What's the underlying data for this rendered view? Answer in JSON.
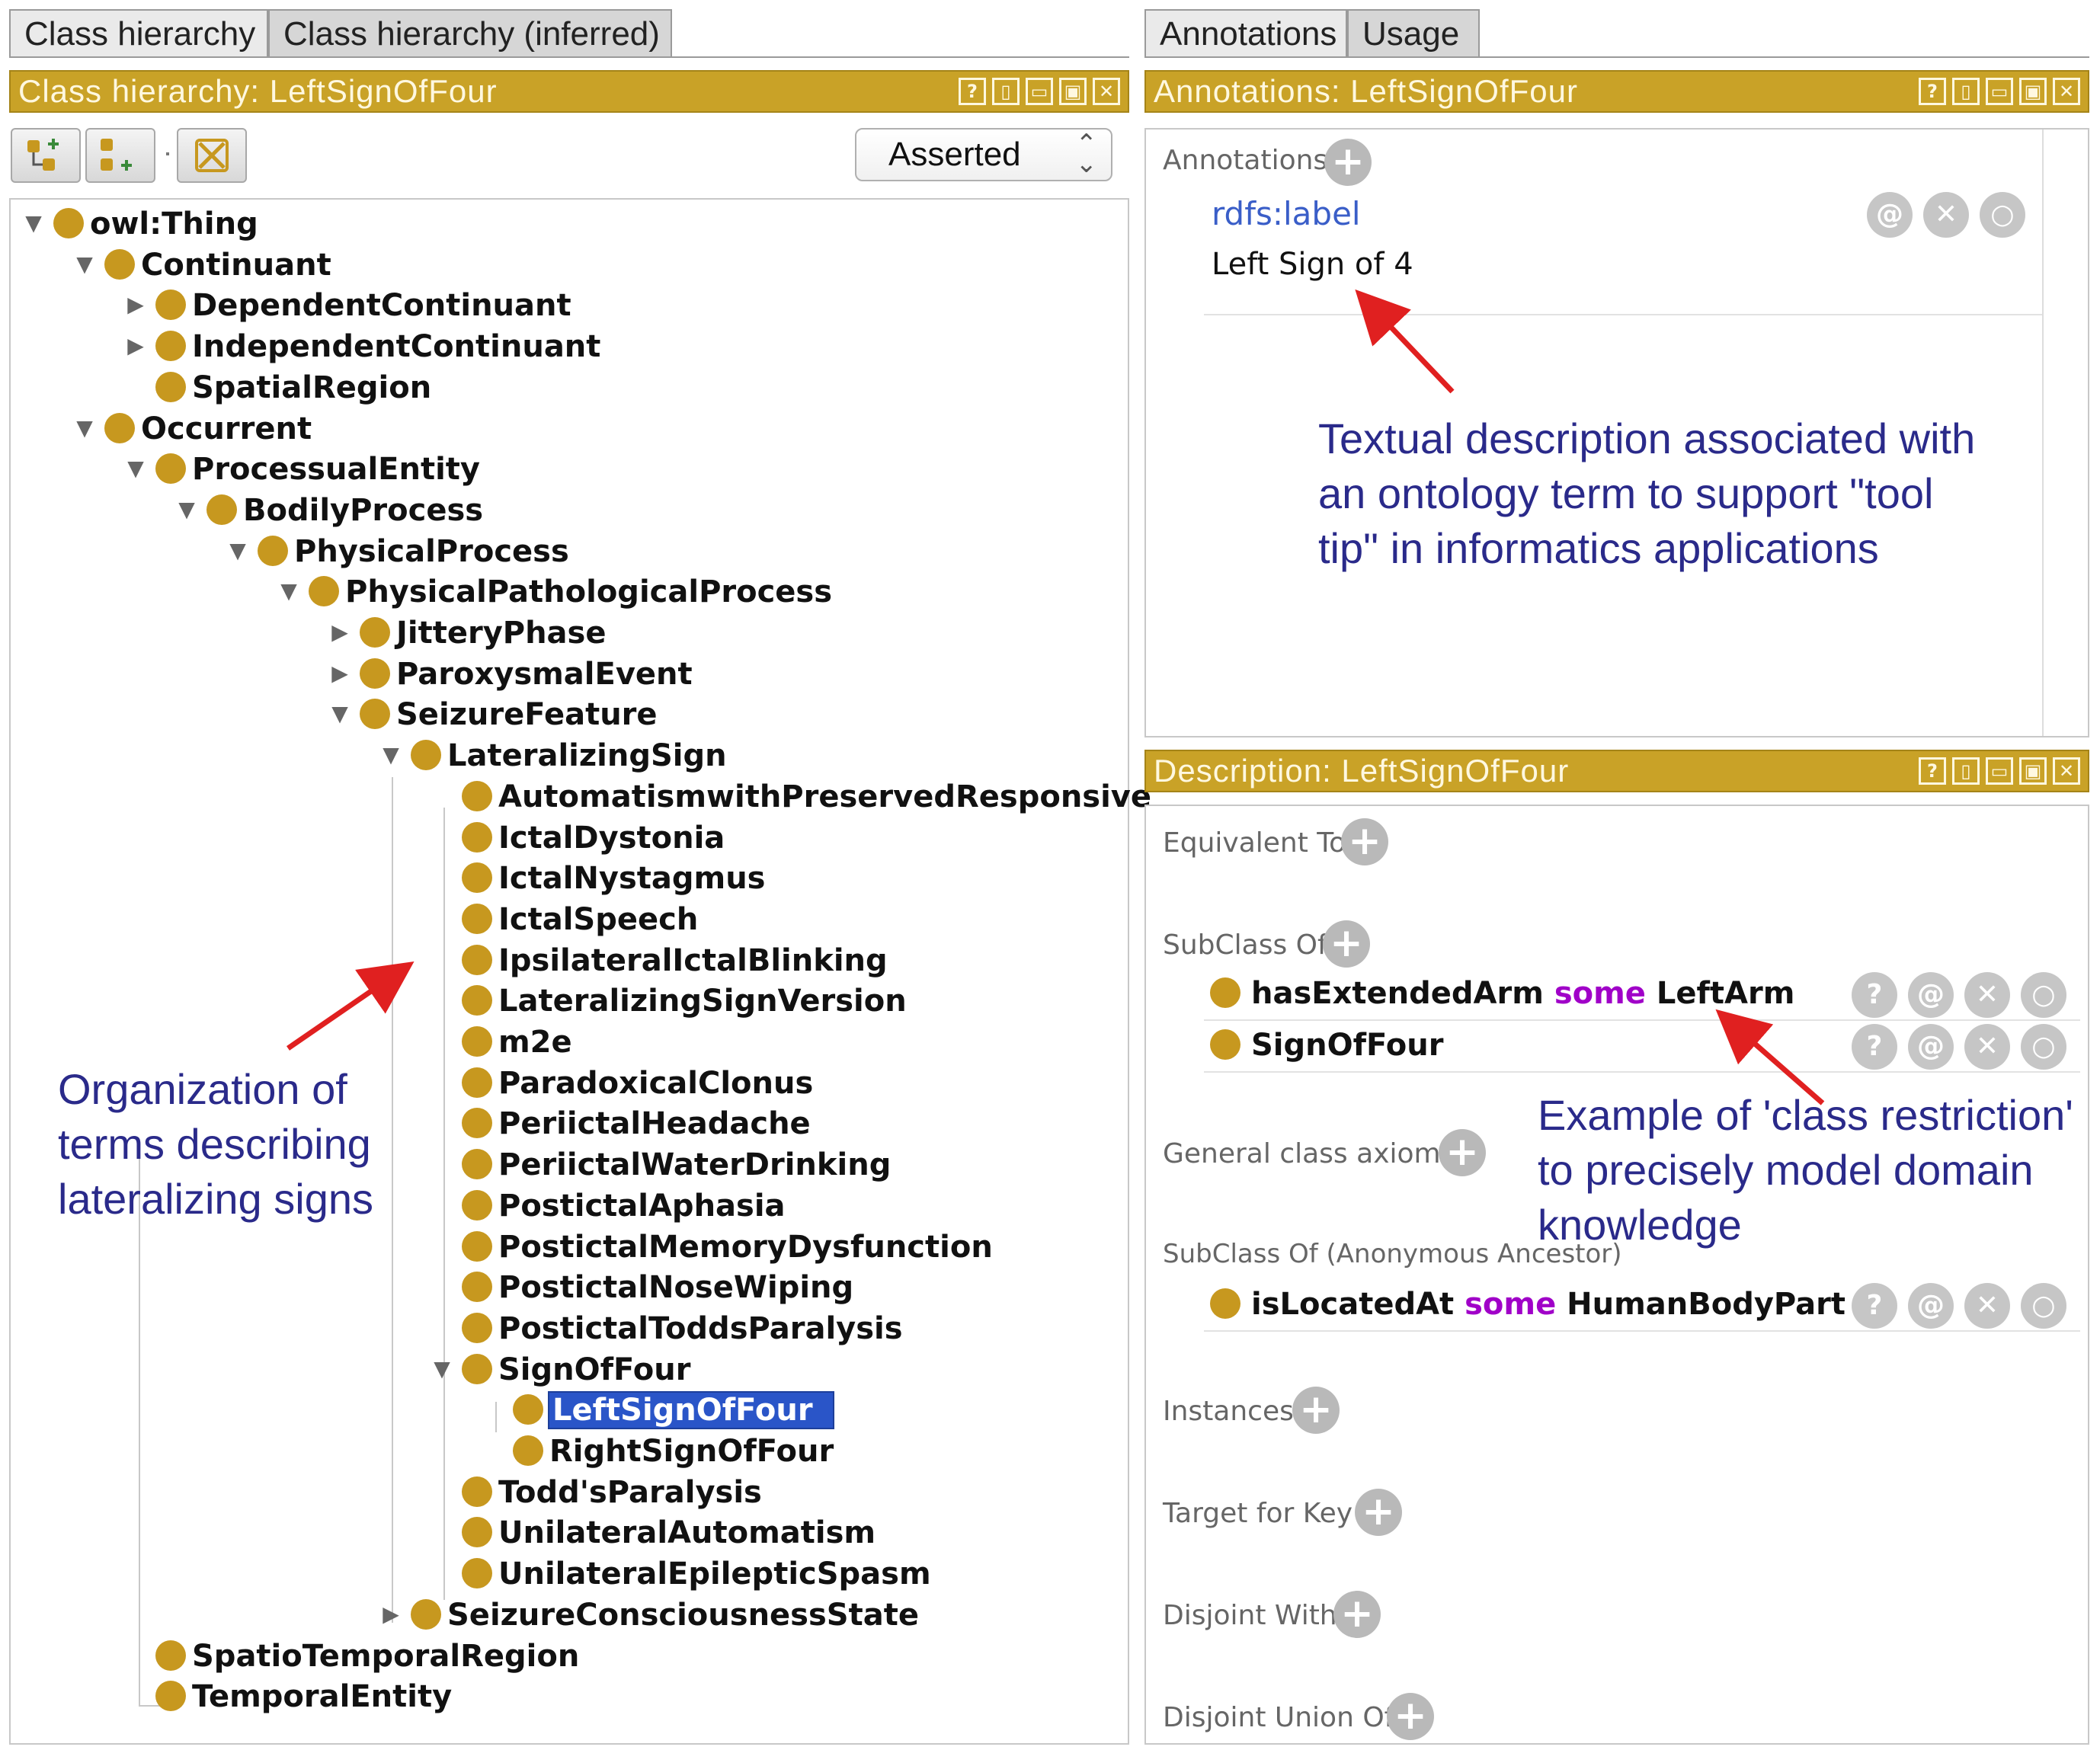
{
  "left_tabs": [
    "Class hierarchy",
    "Class hierarchy (inferred)"
  ],
  "right_tabs": [
    "Annotations",
    "Usage"
  ],
  "left_view_title": "Class hierarchy: LeftSignOfFour",
  "annotations_view_title": "Annotations: LeftSignOfFour",
  "description_view_title": "Description: LeftSignOfFour",
  "view_buttons": [
    "?",
    "▯",
    "▭",
    "▣",
    "✕"
  ],
  "toolbar": {
    "add_subclass_icon": "add-subclass-icon",
    "add_sibling_icon": "add-sibling-icon",
    "delete_icon": "delete-class-icon",
    "mode": "Asserted"
  },
  "tree": [
    {
      "label": "owl:Thing",
      "toggle": "▼"
    },
    {
      "label": "Continuant",
      "toggle": "▼"
    },
    {
      "label": "DependentContinuant",
      "toggle": "▶"
    },
    {
      "label": "IndependentContinuant",
      "toggle": "▶"
    },
    {
      "label": "SpatialRegion",
      "toggle": ""
    },
    {
      "label": "Occurrent",
      "toggle": "▼"
    },
    {
      "label": "ProcessualEntity",
      "toggle": "▼"
    },
    {
      "label": "BodilyProcess",
      "toggle": "▼"
    },
    {
      "label": "PhysicalProcess",
      "toggle": "▼"
    },
    {
      "label": "PhysicalPathologicalProcess",
      "toggle": "▼"
    },
    {
      "label": "JitteryPhase",
      "toggle": "▶"
    },
    {
      "label": "ParoxysmalEvent",
      "toggle": "▶"
    },
    {
      "label": "SeizureFeature",
      "toggle": "▼"
    },
    {
      "label": "LateralizingSign",
      "toggle": "▼"
    },
    {
      "label": "AutomatismwithPreservedResponsive",
      "toggle": ""
    },
    {
      "label": "IctalDystonia",
      "toggle": ""
    },
    {
      "label": "IctalNystagmus",
      "toggle": ""
    },
    {
      "label": "IctalSpeech",
      "toggle": ""
    },
    {
      "label": "IpsilateralIctalBlinking",
      "toggle": ""
    },
    {
      "label": "LateralizingSignVersion",
      "toggle": ""
    },
    {
      "label": "m2e",
      "toggle": ""
    },
    {
      "label": "ParadoxicalClonus",
      "toggle": ""
    },
    {
      "label": "PeriictalHeadache",
      "toggle": ""
    },
    {
      "label": "PeriictalWaterDrinking",
      "toggle": ""
    },
    {
      "label": "PostictalAphasia",
      "toggle": ""
    },
    {
      "label": "PostictalMemoryDysfunction",
      "toggle": ""
    },
    {
      "label": "PostictalNoseWiping",
      "toggle": ""
    },
    {
      "label": "PostictalToddsParalysis",
      "toggle": ""
    },
    {
      "label": "SignOfFour",
      "toggle": "▼"
    },
    {
      "label": "LeftSignOfFour",
      "toggle": "",
      "selected": true
    },
    {
      "label": "RightSignOfFour",
      "toggle": ""
    },
    {
      "label": "Todd'sParalysis",
      "toggle": ""
    },
    {
      "label": "UnilateralAutomatism",
      "toggle": ""
    },
    {
      "label": "UnilateralEpilepticSpasm",
      "toggle": ""
    },
    {
      "label": "SeizureConsciousnessState",
      "toggle": "▶"
    },
    {
      "label": "SpatioTemporalRegion",
      "toggle": ""
    },
    {
      "label": "TemporalEntity",
      "toggle": ""
    }
  ],
  "annotations": {
    "header": "Annotations",
    "property": "rdfs:label",
    "value": "Left Sign of 4",
    "buttons": [
      "@",
      "✕",
      "○"
    ]
  },
  "description": {
    "equivalent_to": "Equivalent To",
    "subclass_of": "SubClass Of",
    "subclass_items": [
      {
        "subject": "hasExtendedArm",
        "keyword": "some",
        "object": "LeftArm"
      },
      {
        "subject": "SignOfFour",
        "keyword": "",
        "object": ""
      }
    ],
    "general_class_axioms": "General class axioms",
    "subclass_of_anonymous": "SubClass Of (Anonymous Ancestor)",
    "anonymous_items": [
      {
        "subject": "isLocatedAt",
        "keyword": "some",
        "object": "HumanBodyPart"
      }
    ],
    "instances": "Instances",
    "target_for_key": "Target for Key",
    "disjoint_with": "Disjoint With",
    "disjoint_union_of": "Disjoint Union Of",
    "axiom_buttons": [
      "?",
      "@",
      "✕",
      "○"
    ]
  },
  "callouts": {
    "tooltip": [
      "Textual description associated with",
      "an ontology term to support \"tool",
      "tip\" in informatics applications"
    ],
    "organization": [
      "Organization of",
      "terms describing",
      "lateralizing signs"
    ],
    "restriction": [
      "Example of 'class restriction'",
      "to precisely model domain",
      "knowledge"
    ]
  },
  "colors": {
    "header_gold": "#c9a227",
    "class_dot": "#c7981f",
    "selection": "#2a55c8",
    "keyword": "#a000c8",
    "callout_text": "#2a2a8a",
    "arrow": "#e02020"
  }
}
